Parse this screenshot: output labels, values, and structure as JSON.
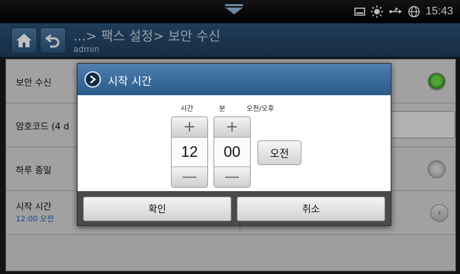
{
  "statusbar": {
    "time": "15:43",
    "icons": [
      "screen-icon",
      "brightness-icon",
      "usb-icon",
      "globe-icon"
    ]
  },
  "header": {
    "breadcrumb": "...> 팩스 설정> 보안 수신",
    "user": "admin"
  },
  "list": {
    "rows": [
      {
        "label": "보안 수신"
      },
      {
        "label": "암호코드 (4 d"
      },
      {
        "label": "하루 종일"
      },
      {
        "label": "시작 시간",
        "sub": "12:00 오전"
      }
    ]
  },
  "dialog": {
    "title": "시작 시간",
    "columns": {
      "hour": "시간",
      "minute": "분",
      "ampm": "오전/오후"
    },
    "hour_value": "12",
    "minute_value": "00",
    "ampm_value": "오전",
    "plus_glyph": "+",
    "minus_glyph": "—",
    "ok_label": "확인",
    "cancel_label": "취소"
  },
  "colors": {
    "header": "#2b5176",
    "accent_green": "#4cbf2c",
    "link_blue": "#1b5fb0"
  }
}
